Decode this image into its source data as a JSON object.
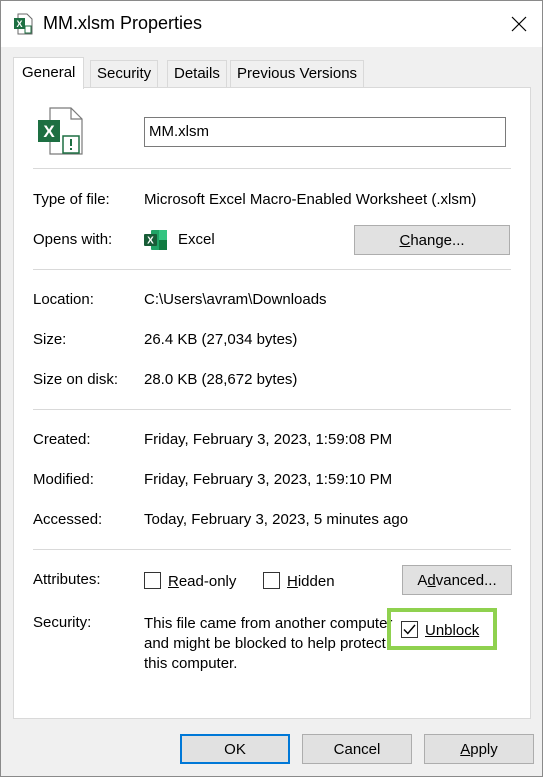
{
  "window": {
    "title": "MM.xlsm Properties",
    "close_glyph": "✕"
  },
  "tabs": [
    {
      "label": "General"
    },
    {
      "label": "Security"
    },
    {
      "label": "Details"
    },
    {
      "label": "Previous Versions"
    }
  ],
  "general": {
    "file_name": "MM.xlsm",
    "type_of_file_label": "Type of file:",
    "type_of_file": "Microsoft Excel Macro-Enabled Worksheet (.xlsm)",
    "opens_with_label": "Opens with:",
    "opens_with": "Excel",
    "change_button": {
      "prefix": "",
      "accel": "C",
      "rest": "hange..."
    },
    "location_label": "Location:",
    "location": "C:\\Users\\avram\\Downloads",
    "size_label": "Size:",
    "size": "26.4 KB (27,034 bytes)",
    "size_on_disk_label": "Size on disk:",
    "size_on_disk": "28.0 KB (28,672 bytes)",
    "created_label": "Created:",
    "created": "Friday, February 3, 2023, 1:59:08 PM",
    "modified_label": "Modified:",
    "modified": "Friday, February 3, 2023, 1:59:10 PM",
    "accessed_label": "Accessed:",
    "accessed": "Today, February 3, 2023, 5 minutes ago",
    "attributes_label": "Attributes:",
    "readonly": {
      "accel": "R",
      "rest": "ead-only",
      "checked": false
    },
    "hidden": {
      "accel": "H",
      "rest": "idden",
      "checked": false
    },
    "advanced_button": {
      "prefix": "A",
      "accel": "d",
      "rest": "vanced..."
    },
    "security_label": "Security:",
    "security_text": "This file came from another computer and might be blocked to help protect this computer.",
    "unblock": {
      "label": "Unblock",
      "checked": true
    }
  },
  "footer": {
    "ok": "OK",
    "cancel": "Cancel",
    "apply": {
      "accel": "A",
      "rest": "pply"
    }
  },
  "colors": {
    "excel_green": "#1d6f42",
    "highlight": "#8fd14f",
    "ok_border": "#0078d7"
  }
}
